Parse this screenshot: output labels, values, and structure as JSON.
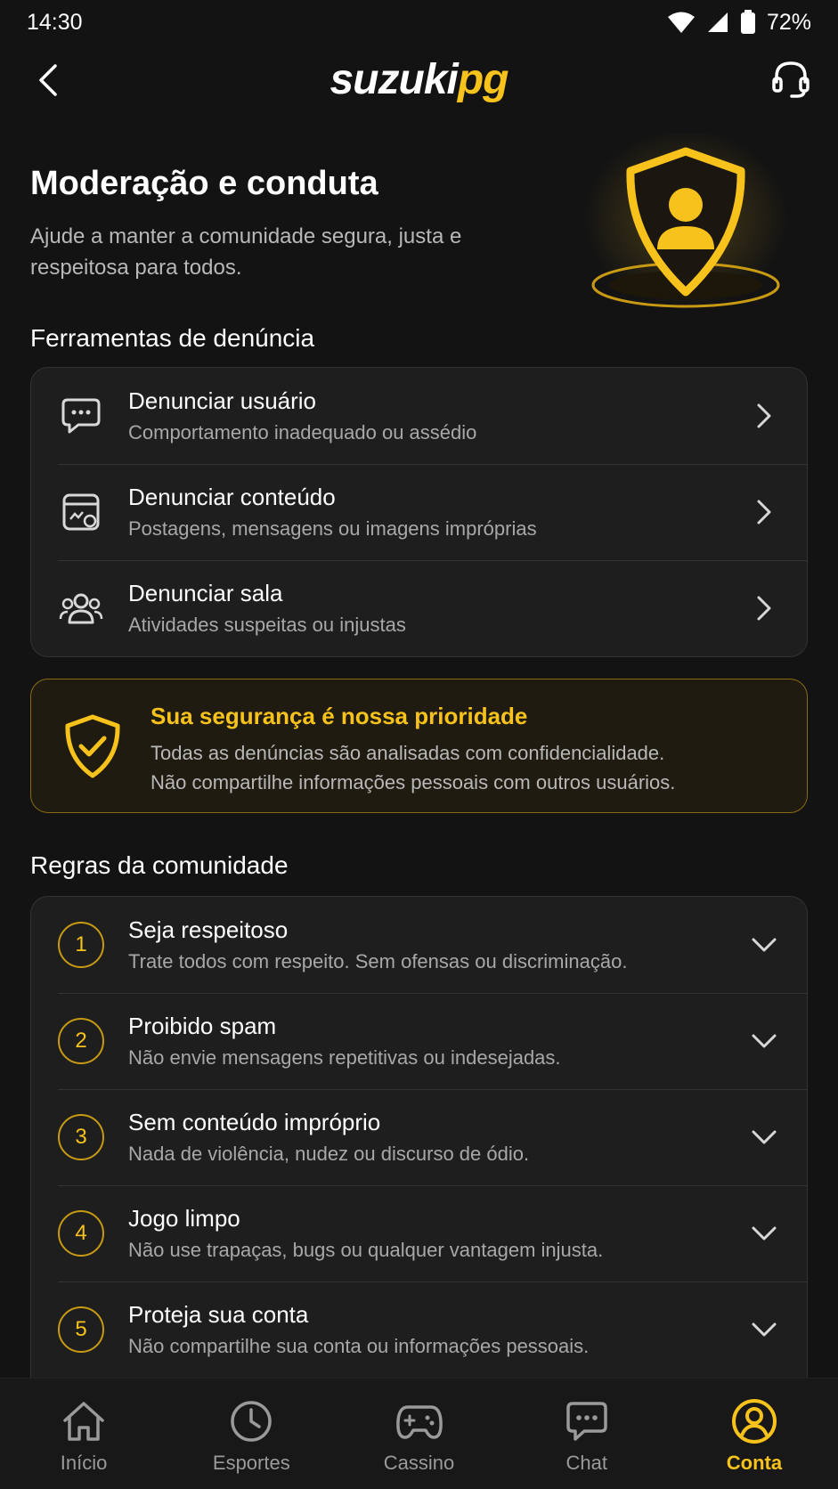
{
  "status_bar": {
    "time": "14:30",
    "battery": "72%"
  },
  "header": {
    "logo_part1": "suzuki",
    "logo_part2": "pg",
    "back_icon": "chevron-left-icon",
    "support_icon": "headset-icon"
  },
  "hero": {
    "title": "Moderação e conduta",
    "subtitle": "Ajude a manter a comunidade segura, justa e respeitosa para todos.",
    "illustration": "shield-user-icon"
  },
  "report_section": {
    "title": "Ferramentas de denúncia",
    "items": [
      {
        "title": "Denunciar usuário",
        "subtitle": "Comportamento inadequado ou assédio",
        "icon": "chat-bubble-icon"
      },
      {
        "title": "Denunciar conteúdo",
        "subtitle": "Postagens, mensagens ou imagens impróprias",
        "icon": "content-report-icon"
      },
      {
        "title": "Denunciar sala",
        "subtitle": "Atividades suspeitas ou injustas",
        "icon": "group-icon"
      }
    ]
  },
  "safety_notice": {
    "title": "Sua segurança é nossa prioridade",
    "line1": "Todas as denúncias são analisadas com confidencialidade.",
    "line2": "Não compartilhe informações pessoais com outros usuários.",
    "icon": "shield-check-icon"
  },
  "rules_section": {
    "title": "Regras da comunidade",
    "items": [
      {
        "number": "1",
        "title": "Seja respeitoso",
        "subtitle": "Trate todos com respeito. Sem ofensas ou discriminação."
      },
      {
        "number": "2",
        "title": "Proibido spam",
        "subtitle": "Não envie mensagens repetitivas ou indesejadas."
      },
      {
        "number": "3",
        "title": "Sem conteúdo impróprio",
        "subtitle": "Nada de violência, nudez ou discurso de ódio."
      },
      {
        "number": "4",
        "title": "Jogo limpo",
        "subtitle": "Não use trapaças, bugs ou qualquer vantagem injusta."
      },
      {
        "number": "5",
        "title": "Proteja sua conta",
        "subtitle": "Não compartilhe sua conta ou informações pessoais."
      }
    ]
  },
  "bottom_nav": {
    "items": [
      {
        "label": "Início",
        "icon": "home-icon"
      },
      {
        "label": "Esportes",
        "icon": "clock-icon"
      },
      {
        "label": "Cassino",
        "icon": "gamepad-icon"
      },
      {
        "label": "Chat",
        "icon": "chat-icon"
      },
      {
        "label": "Conta",
        "icon": "user-circle-icon",
        "active": true
      }
    ]
  },
  "colors": {
    "background": "#131313",
    "card": "#1e1e1f",
    "accent": "#f6c21b",
    "muted_text": "#a8a8a8"
  }
}
